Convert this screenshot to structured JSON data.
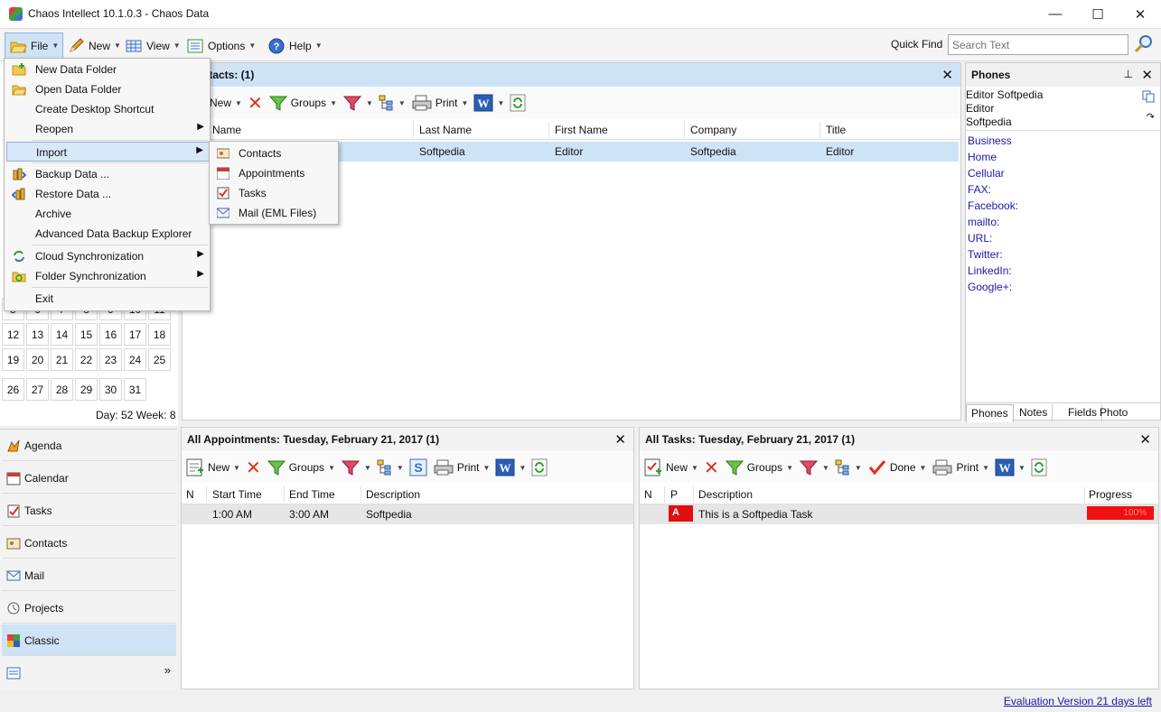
{
  "window": {
    "title": "Chaos Intellect 10.1.0.3 - Chaos Data",
    "minimize": "—",
    "maximize": "☐",
    "close": "✕"
  },
  "menubar": {
    "file": "File",
    "new": "New",
    "view": "View",
    "options": "Options",
    "help": "Help",
    "quick_find_label": "Quick Find",
    "search_placeholder": "Search Text"
  },
  "file_menu": {
    "items": [
      {
        "label": "New Data Folder"
      },
      {
        "label": "Open Data Folder"
      },
      {
        "label": "Create Desktop Shortcut"
      },
      {
        "label": "Reopen"
      },
      {
        "label": "Import"
      },
      {
        "label": "Backup Data ..."
      },
      {
        "label": "Restore Data ..."
      },
      {
        "label": "Archive"
      },
      {
        "label": "Advanced Data Backup Explorer"
      },
      {
        "label": "Cloud Synchronization"
      },
      {
        "label": "Folder Synchronization"
      },
      {
        "label": "Exit"
      }
    ]
  },
  "import_menu": {
    "items": [
      {
        "label": "Contacts"
      },
      {
        "label": "Appointments"
      },
      {
        "label": "Tasks"
      },
      {
        "label": "Mail (EML Files)"
      }
    ]
  },
  "contacts_panel": {
    "title": "Contacts:  (1)",
    "toolbar": {
      "new": "New",
      "groups": "Groups",
      "print": "Print"
    },
    "columns": [
      "Name",
      "Last Name",
      "First Name",
      "Company",
      "Title"
    ],
    "rows": [
      {
        "last": "Softpedia",
        "first": "Editor",
        "company": "Softpedia",
        "title": "Editor"
      }
    ]
  },
  "calendar": {
    "rows": [
      [
        "5",
        "6",
        "7",
        "8",
        "9",
        "10",
        "11"
      ],
      [
        "12",
        "13",
        "14",
        "15",
        "16",
        "17",
        "18"
      ],
      [
        "19",
        "20",
        "21",
        "22",
        "23",
        "24",
        "25"
      ],
      [
        "26",
        "27",
        "28",
        "29",
        "30",
        "31",
        ""
      ]
    ],
    "day_week": "Day: 52  Week: 8"
  },
  "nav": {
    "items": [
      {
        "label": "Agenda"
      },
      {
        "label": "Calendar"
      },
      {
        "label": "Tasks"
      },
      {
        "label": "Contacts"
      },
      {
        "label": "Mail"
      },
      {
        "label": "Projects"
      },
      {
        "label": "Classic"
      }
    ],
    "more": "»"
  },
  "phones_panel": {
    "title": "Phones",
    "contact_lines": [
      "Editor Softpedia",
      "Editor",
      "Softpedia"
    ],
    "links": [
      "Business",
      "Home",
      "Cellular",
      "FAX:",
      "Facebook:",
      "mailto:",
      "URL:",
      "Twitter:",
      "LinkedIn:",
      "Google+:"
    ],
    "tabs": [
      "Phones",
      "Notes",
      "Fields",
      "Photo"
    ]
  },
  "appointments_panel": {
    "title": "All Appointments: Tuesday, February 21, 2017  (1)",
    "toolbar": {
      "new": "New",
      "groups": "Groups",
      "print": "Print"
    },
    "columns": [
      "N",
      "Start Time",
      "End Time",
      "Description"
    ],
    "rows": [
      {
        "start": "1:00 AM",
        "end": "3:00 AM",
        "description": "Softpedia"
      }
    ]
  },
  "tasks_panel": {
    "title": "All Tasks: Tuesday, February 21, 2017  (1)",
    "toolbar": {
      "new": "New",
      "groups": "Groups",
      "done": "Done",
      "print": "Print"
    },
    "columns": [
      "N",
      "P",
      "Description",
      "Progress"
    ],
    "rows": [
      {
        "priority": "A",
        "description": "This is a Softpedia Task",
        "progress": "100%"
      }
    ]
  },
  "status": {
    "evaluation": "Evaluation Version 21 days left"
  },
  "colors": {
    "accent": "#cfe3f7",
    "link": "#1a1aa8",
    "priority": "#e01010"
  }
}
